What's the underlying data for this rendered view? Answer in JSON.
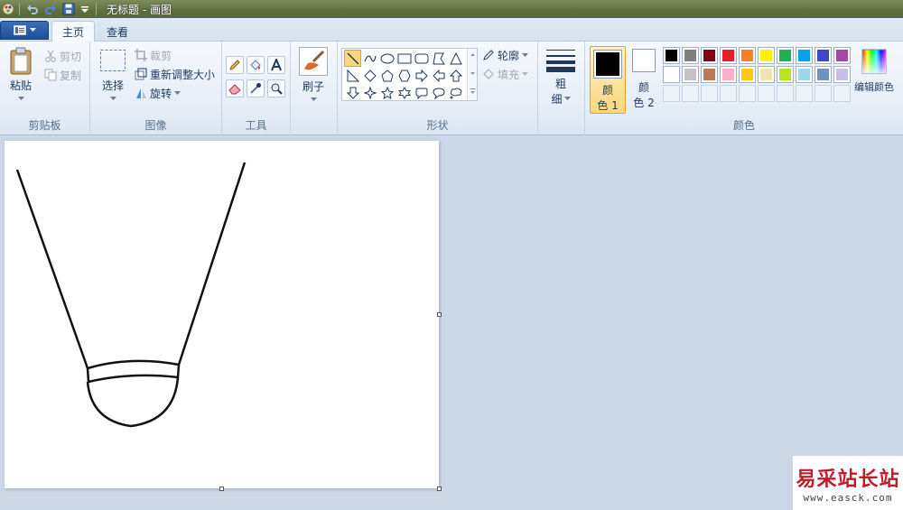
{
  "window": {
    "title": "无标题 - 画图"
  },
  "tabs": [
    {
      "label": "主页",
      "active": true
    },
    {
      "label": "查看",
      "active": false
    }
  ],
  "clipboard": {
    "paste_label": "粘贴",
    "cut_label": "剪切",
    "copy_label": "复制",
    "group_label": "剪贴板"
  },
  "image": {
    "select_label": "选择",
    "crop_label": "裁剪",
    "resize_label": "重新调整大小",
    "rotate_label": "旋转",
    "group_label": "图像"
  },
  "tools": {
    "group_label": "工具",
    "items": [
      "pencil-icon",
      "fill-icon",
      "text-icon",
      "eraser-icon",
      "color-picker-icon",
      "magnifier-icon"
    ]
  },
  "brushes": {
    "label": "刷子"
  },
  "shapes": {
    "group_label": "形状",
    "outline_label": "轮廓",
    "fill_label": "填充",
    "items": [
      "line",
      "curve",
      "oval",
      "rectangle",
      "rounded-rectangle",
      "polygon",
      "triangle",
      "right-triangle",
      "diamond",
      "pentagon",
      "hexagon",
      "right-arrow",
      "left-arrow",
      "up-arrow",
      "down-arrow",
      "four-point-star",
      "five-point-star",
      "six-point-star",
      "rounded-callout",
      "oval-callout",
      "cloud-callout"
    ]
  },
  "size": {
    "label_1": "粗",
    "label_2": "细"
  },
  "colors": {
    "group_label": "颜色",
    "color1_label_1": "颜",
    "color1_label_2": "色 1",
    "color2_label_1": "颜",
    "color2_label_2": "色 2",
    "color1": "#000000",
    "color2": "#ffffff",
    "edit_label": "编辑颜色",
    "palette_row1": [
      "#000000",
      "#7f7f7f",
      "#880015",
      "#ed1c24",
      "#ff7f27",
      "#fff200",
      "#22b14c",
      "#00a2e8",
      "#3f48cc",
      "#a349a4"
    ],
    "palette_row2": [
      "#ffffff",
      "#c3c3c3",
      "#b97a57",
      "#ffaec9",
      "#ffc90e",
      "#efe4b0",
      "#b5e61d",
      "#99d9ea",
      "#7092be",
      "#c8bfe7"
    ]
  },
  "watermark": {
    "main": "易采站长站",
    "sub": "www.easck.com"
  }
}
